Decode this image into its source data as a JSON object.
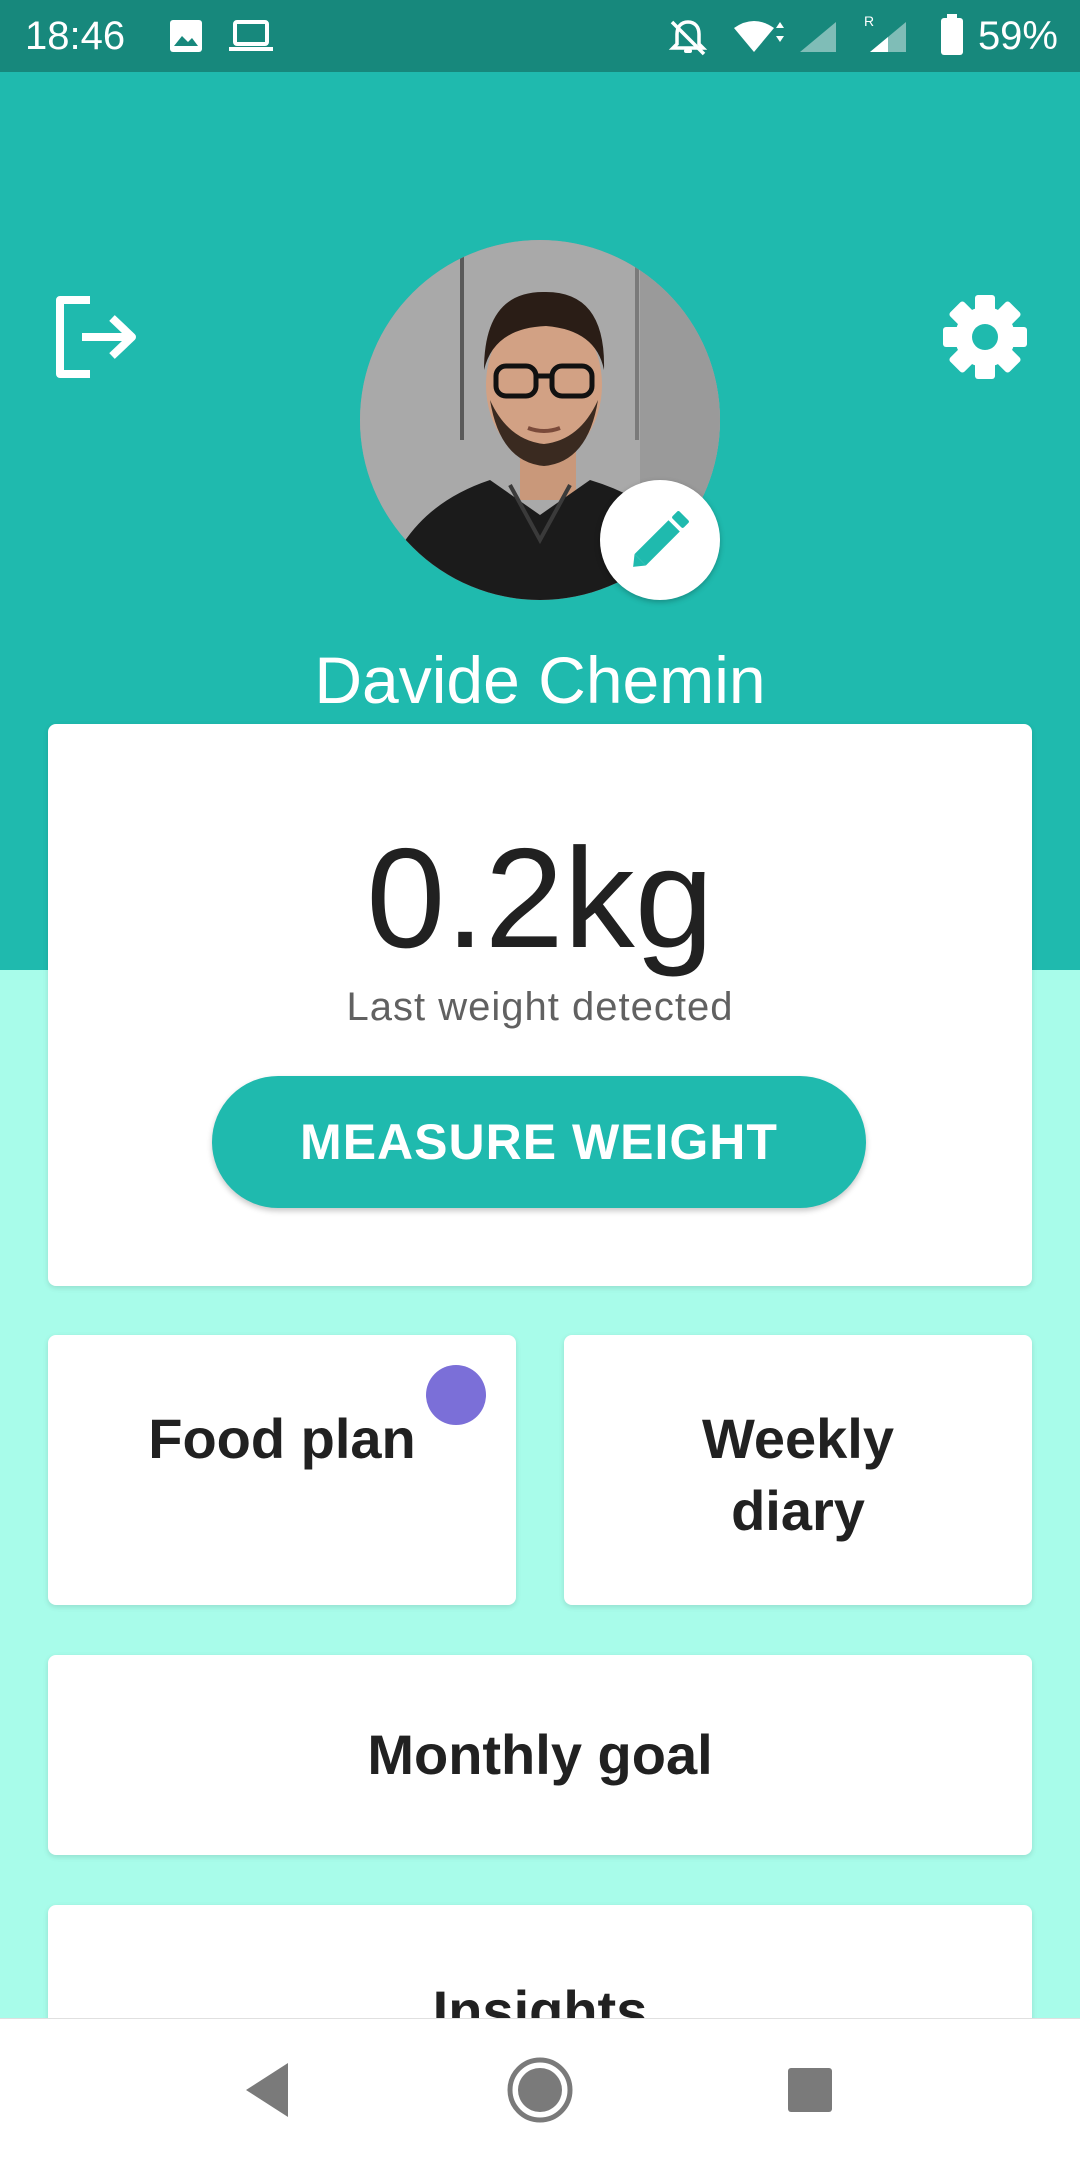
{
  "status_bar": {
    "time": "18:46",
    "battery_percent": "59%",
    "icons": [
      "image-icon",
      "laptop-icon",
      "notifications-off-icon",
      "wifi-icon",
      "signal-icon",
      "signal-roaming-icon",
      "battery-icon"
    ]
  },
  "header": {
    "user_name": "Davide Chemin",
    "logout_icon": "logout-icon",
    "settings_icon": "gear-icon",
    "edit_icon": "pencil-icon"
  },
  "weight_card": {
    "value": "0.2kg",
    "caption": "Last weight detected",
    "button_label": "MEASURE WEIGHT"
  },
  "tiles": {
    "food_plan": "Food plan",
    "weekly_diary_line1": "Weekly",
    "weekly_diary_line2": "diary",
    "monthly_goal": "Monthly goal",
    "insights": "Insights"
  },
  "colors": {
    "status_bar": "#17887C",
    "primary": "#1FBAAE",
    "background": "#A8FCEA",
    "notification_dot": "#7B6FD8"
  }
}
